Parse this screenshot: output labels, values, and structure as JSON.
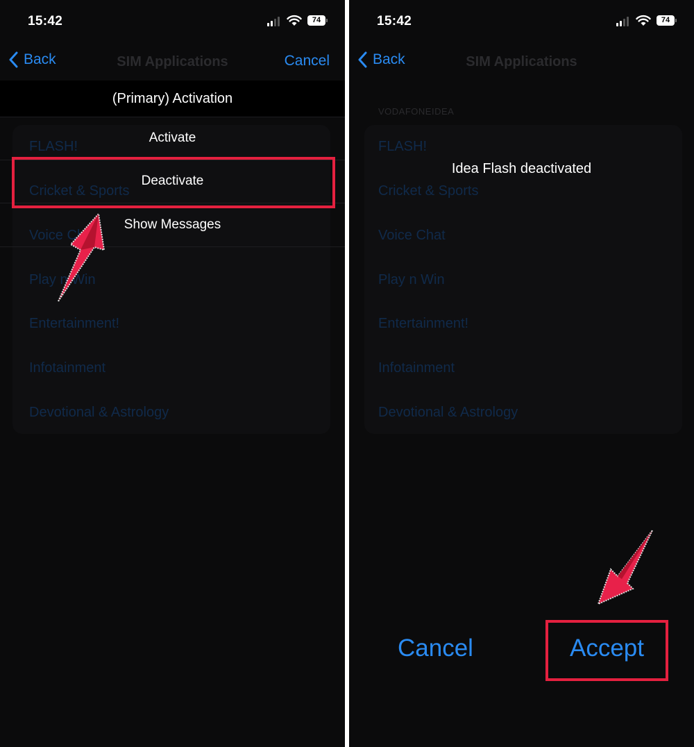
{
  "left": {
    "status": {
      "time": "15:42",
      "battery": "74"
    },
    "nav": {
      "back": "Back",
      "title": "SIM Applications",
      "cancel": "Cancel"
    },
    "list_items": [
      "FLASH!",
      "Cricket & Sports",
      "Voice Chat",
      "Play n Win",
      "Entertainment!",
      "Infotainment",
      "Devotional & Astrology"
    ],
    "sheet": {
      "title": "(Primary) Activation",
      "options": [
        "Activate",
        "Deactivate",
        "Show Messages"
      ]
    }
  },
  "right": {
    "status": {
      "time": "15:42",
      "battery": "74"
    },
    "nav": {
      "back": "Back",
      "title": "SIM Applications"
    },
    "section_header": "VODAFONEIDEA",
    "list_items": [
      "FLASH!",
      "Cricket & Sports",
      "Voice Chat",
      "Play n Win",
      "Entertainment!",
      "Infotainment",
      "Devotional & Astrology"
    ],
    "dialog": {
      "message": "Idea Flash deactivated",
      "cancel": "Cancel",
      "accept": "Accept"
    }
  },
  "colors": {
    "accent_blue": "#2a8bf2",
    "highlight_red": "#e4203f",
    "background": "#0b0b0c"
  }
}
